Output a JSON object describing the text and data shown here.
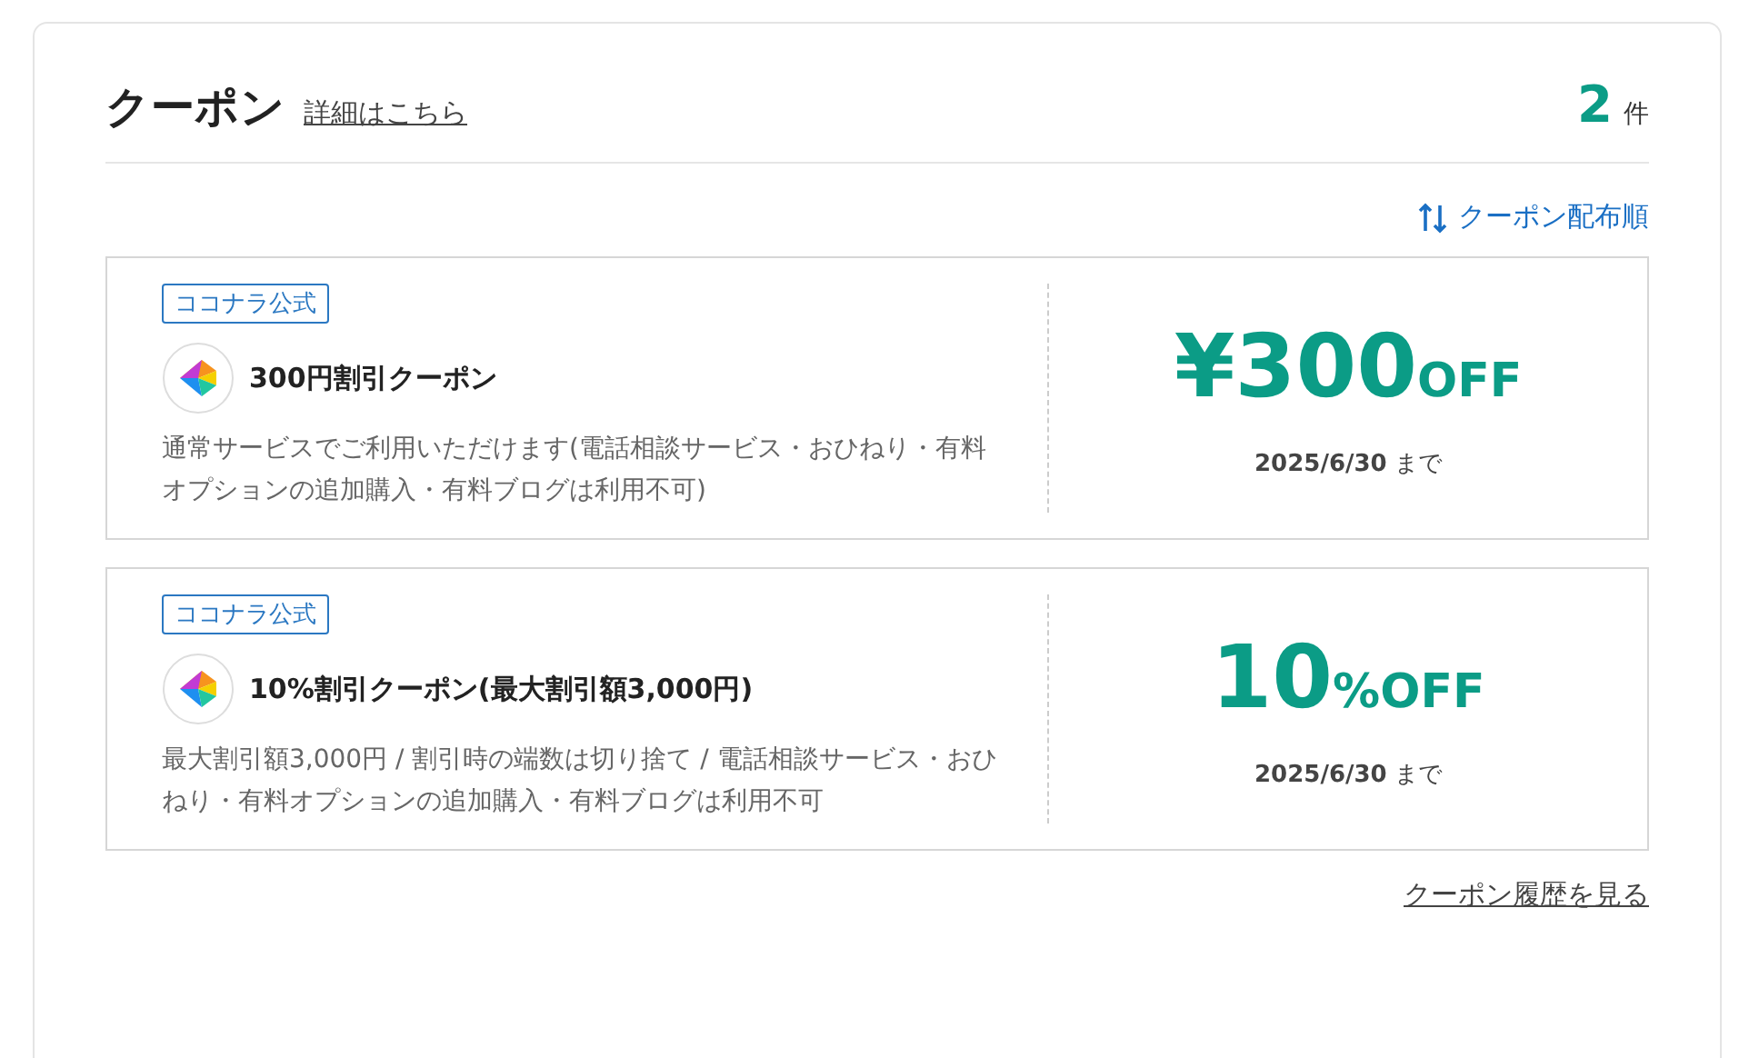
{
  "header": {
    "title": "クーポン",
    "details_link": "詳細はこちら",
    "count": "2",
    "count_unit": "件"
  },
  "sort": {
    "label": "クーポン配布順"
  },
  "coupons": [
    {
      "tag": "ココナラ公式",
      "name": "300円割引クーポン",
      "description": "通常サービスでご利用いただけます(電話相談サービス・おひねり・有料オプションの追加購入・有料ブログは利用不可)",
      "amount": "¥300",
      "unit": "OFF",
      "expiry": "**2025/6/30** まで"
    },
    {
      "tag": "ココナラ公式",
      "name": "10%割引クーポン(最大割引額3,000円)",
      "description": "最大割引額3,000円 / 割引時の端数は切り捨て / 電話相談サービス・おひねり・有料オプションの追加購入・有料ブログは利用不可",
      "amount": "10",
      "unit": "%OFF",
      "expiry": "**2025/6/30** まで"
    }
  ],
  "history_link": "クーポン履歴を見る"
}
